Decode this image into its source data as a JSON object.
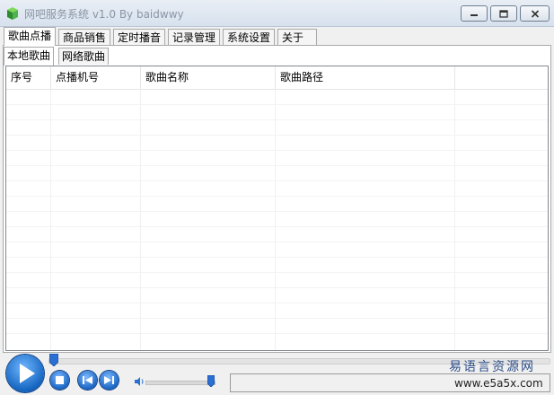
{
  "window": {
    "title": "网吧服务系统 v1.0 By baidwwy",
    "icons": {
      "app": "green-cube-icon",
      "minimize": "minimize-icon",
      "maximize": "maximize-icon",
      "close": "close-icon"
    }
  },
  "main_tabs": [
    {
      "label": "歌曲点播",
      "active": true
    },
    {
      "label": "商品销售",
      "active": false
    },
    {
      "label": "定时播音",
      "active": false
    },
    {
      "label": "记录管理",
      "active": false
    },
    {
      "label": "系统设置",
      "active": false
    },
    {
      "label": "关于",
      "active": false
    }
  ],
  "sub_tabs": [
    {
      "label": "本地歌曲",
      "active": true
    },
    {
      "label": "网络歌曲",
      "active": false
    }
  ],
  "song_list": {
    "columns": [
      "序号",
      "点播机号",
      "歌曲名称",
      "歌曲路径",
      ""
    ],
    "rows": []
  },
  "player": {
    "icons": {
      "play": "play-icon",
      "stop": "stop-icon",
      "prev": "previous-icon",
      "next": "next-icon",
      "volume": "speaker-icon"
    },
    "seek_position": 0,
    "volume_level": 1.0,
    "status_text": ""
  },
  "watermark": {
    "line1": "易语言资源网",
    "line2": "www.e5a5x.com"
  }
}
